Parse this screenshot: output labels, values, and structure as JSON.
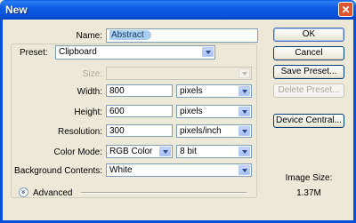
{
  "window": {
    "title": "New",
    "close_glyph": "✕"
  },
  "fields": {
    "name": {
      "label": "Name:",
      "value": "Abstract"
    },
    "preset": {
      "label": "Preset:",
      "value": "Clipboard"
    },
    "size": {
      "label": "Size:",
      "value": ""
    },
    "width": {
      "label": "Width:",
      "value": "800",
      "unit": "pixels"
    },
    "height": {
      "label": "Height:",
      "value": "600",
      "unit": "pixels"
    },
    "resolution": {
      "label": "Resolution:",
      "value": "300",
      "unit": "pixels/inch"
    },
    "color_mode": {
      "label": "Color Mode:",
      "value": "RGB Color",
      "depth": "8 bit"
    },
    "background": {
      "label": "Background Contents:",
      "value": "White"
    }
  },
  "advanced": {
    "label": "Advanced",
    "icon": "chevron-double-down-icon",
    "glyph": "»"
  },
  "buttons": {
    "ok": "OK",
    "cancel": "Cancel",
    "save_preset": "Save Preset...",
    "delete_preset": "Delete Preset...",
    "device_central": "Device Central..."
  },
  "image_size": {
    "label": "Image Size:",
    "value": "1.37M"
  },
  "colors": {
    "titlebar": "#0a5ee0",
    "dialog_bg": "#ece9d8",
    "close": "#e0542e",
    "selection": "#aacfee"
  }
}
